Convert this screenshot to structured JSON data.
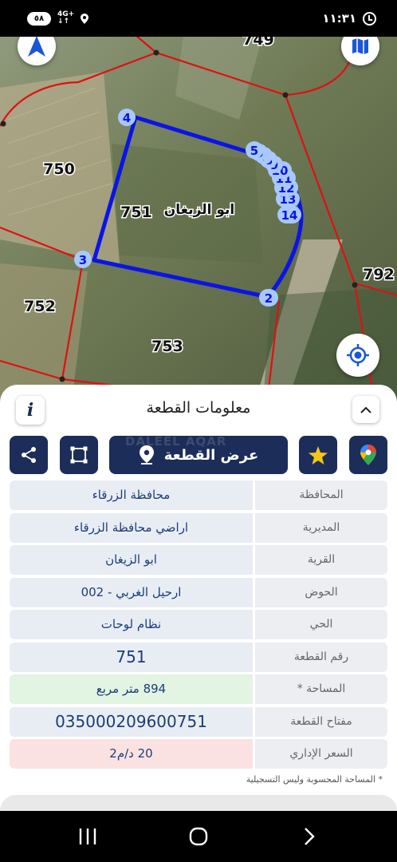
{
  "status_bar": {
    "battery": "٥٨",
    "network_top": "4G+",
    "network_bottom": "↓↑",
    "time": "١١:٣١"
  },
  "map": {
    "parcel_labels": {
      "p749": "749",
      "p750": "750",
      "p751": "751",
      "p752": "752",
      "p753": "753",
      "p792": "792"
    },
    "village_label": "ابو الزيغان",
    "vertex_labels": [
      "4",
      "3",
      "2",
      "14",
      "13",
      "12",
      "11",
      "10",
      "9",
      "8",
      "7",
      "6",
      "5"
    ],
    "colors": {
      "selected_boundary": "#0a14e6",
      "parcel_lines": "#e01010",
      "vertex_fill": "#a8c8ff"
    }
  },
  "panel": {
    "title": "معلومات القطعة",
    "info_label": "i",
    "show_button_label": "عرض القطعة",
    "watermark": "DALEEL AQAR",
    "rows": [
      {
        "label": "المحافظة",
        "value": "محافظة الزرقاء"
      },
      {
        "label": "المديرية",
        "value": "اراضي محافظة الزرقاء"
      },
      {
        "label": "القرية",
        "value": "ابو الزيغان"
      },
      {
        "label": "الحوض",
        "value": "ارحيل الغربي - 002"
      },
      {
        "label": "الحي",
        "value": "نظام لوحات"
      },
      {
        "label": "رقم القطعة",
        "value": "751"
      },
      {
        "label": "المساحة *",
        "value": "894  متر مربع"
      },
      {
        "label": "مفتاح القطعة",
        "value": "035000209600751"
      },
      {
        "label": "السعر الإداري",
        "value": "20 د/م2"
      }
    ],
    "footnote": "* المساحة المحسوبة وليس التسجيلية"
  },
  "colors": {
    "primary": "#1c2d5a",
    "value_text": "#1c3d7a",
    "area_bg": "#e2f4e2",
    "price_bg": "#fbe2e2"
  }
}
